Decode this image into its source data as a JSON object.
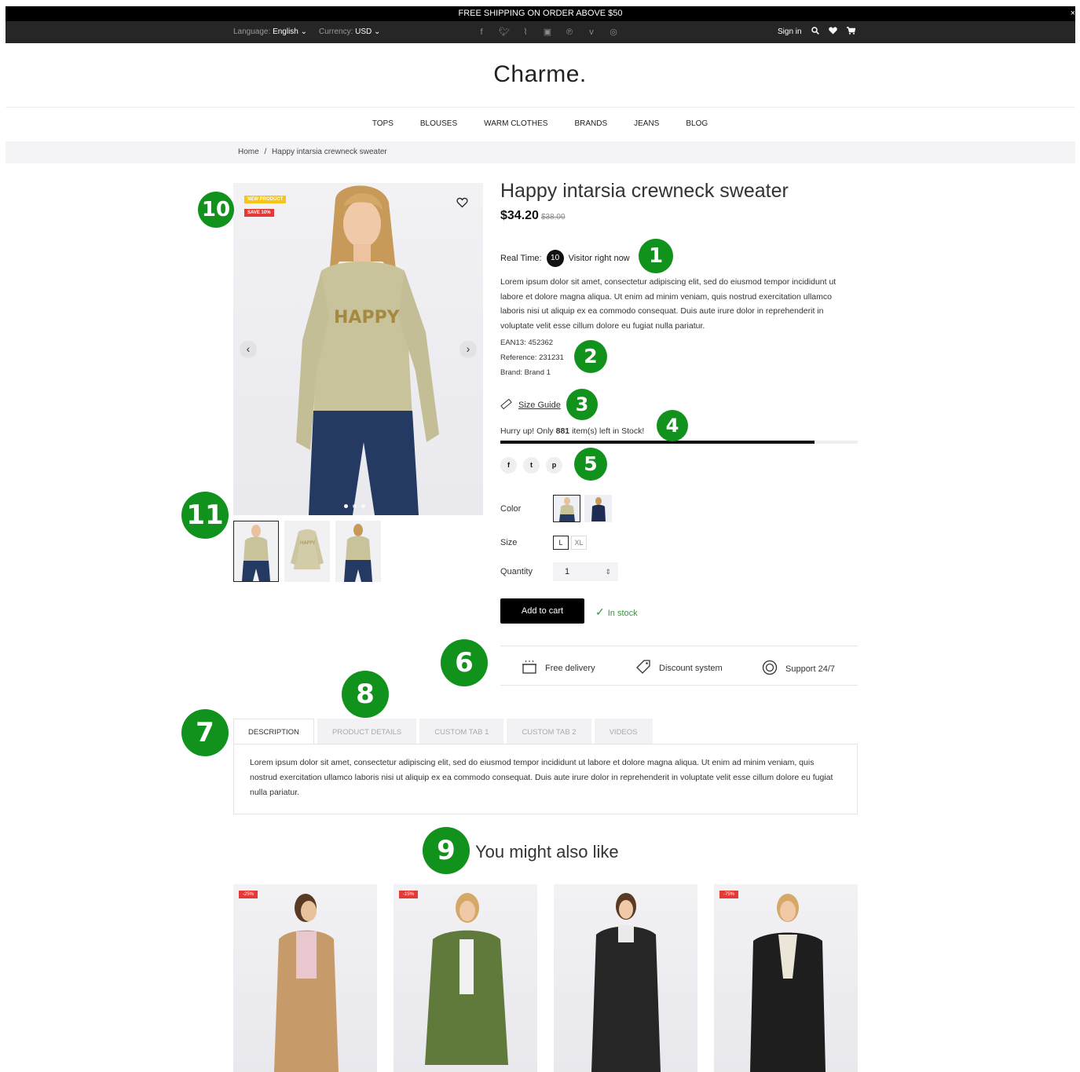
{
  "promo": {
    "text": "FREE SHIPPING ON ORDER ABOVE $50",
    "close": "×"
  },
  "topbar": {
    "language_label": "Language:",
    "language_value": "English",
    "currency_label": "Currency:",
    "currency_value": "USD",
    "social_icons": [
      "facebook-icon",
      "twitter-icon",
      "rss-icon",
      "youtube-icon",
      "pinterest-icon",
      "vimeo-icon",
      "instagram-icon"
    ],
    "signin": "Sign in"
  },
  "logo": "Charme.",
  "nav": [
    "TOPS",
    "BLOUSES",
    "WARM CLOTHES",
    "BRANDS",
    "JEANS",
    "BLOG"
  ],
  "breadcrumb": {
    "home": "Home",
    "sep": "/",
    "current": "Happy intarsia crewneck sweater"
  },
  "gallery": {
    "badge_new": "NEW PRODUCT",
    "badge_save": "SAVE 10%",
    "slide_count": 3,
    "active_slide": 1
  },
  "product": {
    "title": "Happy intarsia crewneck sweater",
    "price": "$34.20",
    "old_price": "$38.00",
    "realtime_label": "Real Time:",
    "visitors": "10",
    "visitors_text": "Visitor right now",
    "description": "Lorem ipsum dolor sit amet, consectetur adipiscing elit, sed do eiusmod tempor incididunt ut labore et dolore magna aliqua. Ut enim ad minim veniam, quis nostrud exercitation ullamco laboris nisi ut aliquip ex ea commodo consequat. Duis aute irure dolor in reprehenderit in voluptate velit esse cillum dolore eu fugiat nulla pariatur.",
    "ean": "EAN13: 452362",
    "reference": "Reference: 231231",
    "brand": "Brand: Brand 1",
    "size_guide": "Size Guide",
    "hurry_prefix": "Hurry up! Only",
    "stock_count": "881",
    "hurry_suffix": "item(s) left in Stock!",
    "stock_fraction": 0.88,
    "color_label": "Color",
    "size_label": "Size",
    "sizes": [
      "L",
      "XL"
    ],
    "quantity_label": "Quantity",
    "quantity": "1",
    "add_to_cart": "Add to cart",
    "in_stock": "In stock"
  },
  "features": [
    {
      "icon": "delivery-box-icon",
      "label": "Free delivery"
    },
    {
      "icon": "price-tag-icon",
      "label": "Discount system"
    },
    {
      "icon": "lifebuoy-icon",
      "label": "Support 24/7"
    }
  ],
  "tabs": [
    "DESCRIPTION",
    "PRODUCT DETAILS",
    "CUSTOM TAB 1",
    "CUSTOM TAB 2",
    "VIDEOS"
  ],
  "tab_body": "Lorem ipsum dolor sit amet, consectetur adipiscing elit, sed do eiusmod tempor incididunt ut labore et dolore magna aliqua. Ut enim ad minim veniam, quis nostrud exercitation ullamco laboris nisi ut aliquip ex ea commodo consequat. Duis aute irure dolor in reprehenderit in voluptate velit esse cillum dolore eu fugiat nulla pariatur.",
  "related": {
    "title": "You might also like",
    "items": [
      {
        "discount": "-25%"
      },
      {
        "discount": "-15%"
      },
      {
        "discount": ""
      },
      {
        "discount": "-75%"
      }
    ]
  },
  "annotations": [
    "1",
    "2",
    "3",
    "4",
    "5",
    "6",
    "7",
    "8",
    "9",
    "10",
    "11"
  ],
  "colors": {
    "annotation": "#11921c",
    "sale_badge": "#e53935",
    "new_badge": "#f5c518",
    "in_stock": "#2e9a3a"
  }
}
